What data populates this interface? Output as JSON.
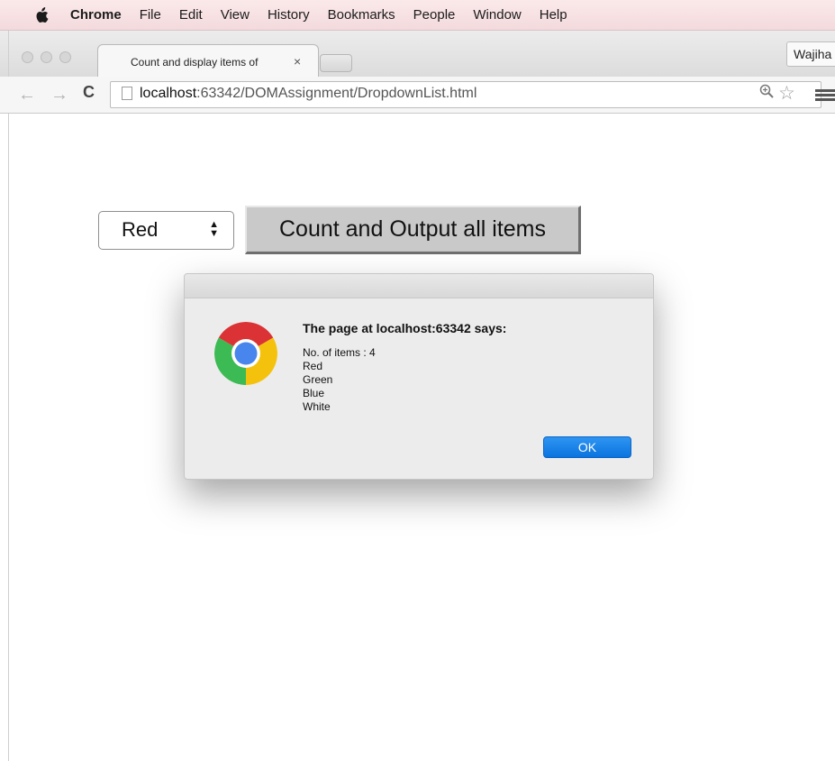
{
  "menubar": {
    "app_name": "Chrome",
    "items": [
      "File",
      "Edit",
      "View",
      "History",
      "Bookmarks",
      "People",
      "Window",
      "Help"
    ]
  },
  "tabs": {
    "active_title": "Count and display items of",
    "close_glyph": "×",
    "profile_name": "Wajiha"
  },
  "toolbar": {
    "url_host": "localhost",
    "url_rest": ":63342/DOMAssignment/DropdownList.html"
  },
  "page": {
    "select_value": "Red",
    "button_label": "Count and Output all items"
  },
  "dialog": {
    "heading": "The page at localhost:63342 says:",
    "lines": [
      "No. of items : 4",
      "Red",
      "Green",
      "Blue",
      "White"
    ],
    "ok_label": "OK"
  },
  "colors": {
    "ok_button": "#0a74df",
    "chrome_red": "#db3236",
    "chrome_yellow": "#f4c20d",
    "chrome_green": "#3cba54",
    "chrome_blue": "#4885ed"
  }
}
